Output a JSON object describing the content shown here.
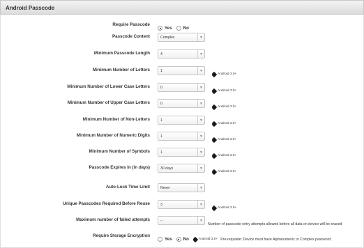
{
  "panel": {
    "title": "Android Passcode"
  },
  "tag": {
    "text": "Android 3.0+"
  },
  "radio_labels": {
    "yes": "Yes",
    "no": "No"
  },
  "rows": {
    "require_passcode": {
      "label": "Require Passcode",
      "selected": "Yes"
    },
    "passcode_content": {
      "label": "Passcode Content",
      "value": "Complex"
    },
    "min_length": {
      "label": "Minimum Passcode Length",
      "value": "4"
    },
    "min_letters": {
      "label": "Minimum Number of Letters",
      "value": "1"
    },
    "min_lower": {
      "label": "Minimum Number of Lower Case Letters",
      "value": "0"
    },
    "min_upper": {
      "label": "Minimum Number of Upper Case Letters",
      "value": "0"
    },
    "min_nonletters": {
      "label": "Minimum Number of Non-Letters",
      "value": "1"
    },
    "min_numeric": {
      "label": "Minimum Number of Numeric Digits",
      "value": "1"
    },
    "min_symbols": {
      "label": "Minimum Number of Symbols",
      "value": "1"
    },
    "expires": {
      "label": "Passcode Expires In (in days)",
      "value": "30 days"
    },
    "autolock": {
      "label": "Auto-Lock Time Limit",
      "value": "Never"
    },
    "unique": {
      "label": "Unique Passcodes Required Before Reuse",
      "value": "3"
    },
    "failed": {
      "label": "Maximum number of failed attempts",
      "value": "--",
      "note": "Number of passcode entry attempts allowed before all data on device will be erased"
    },
    "encryption": {
      "label": "Require Storage Encryption",
      "selected": "No",
      "note": "Pre-requisite: Device must have Alphanumeric or Complex password."
    }
  }
}
